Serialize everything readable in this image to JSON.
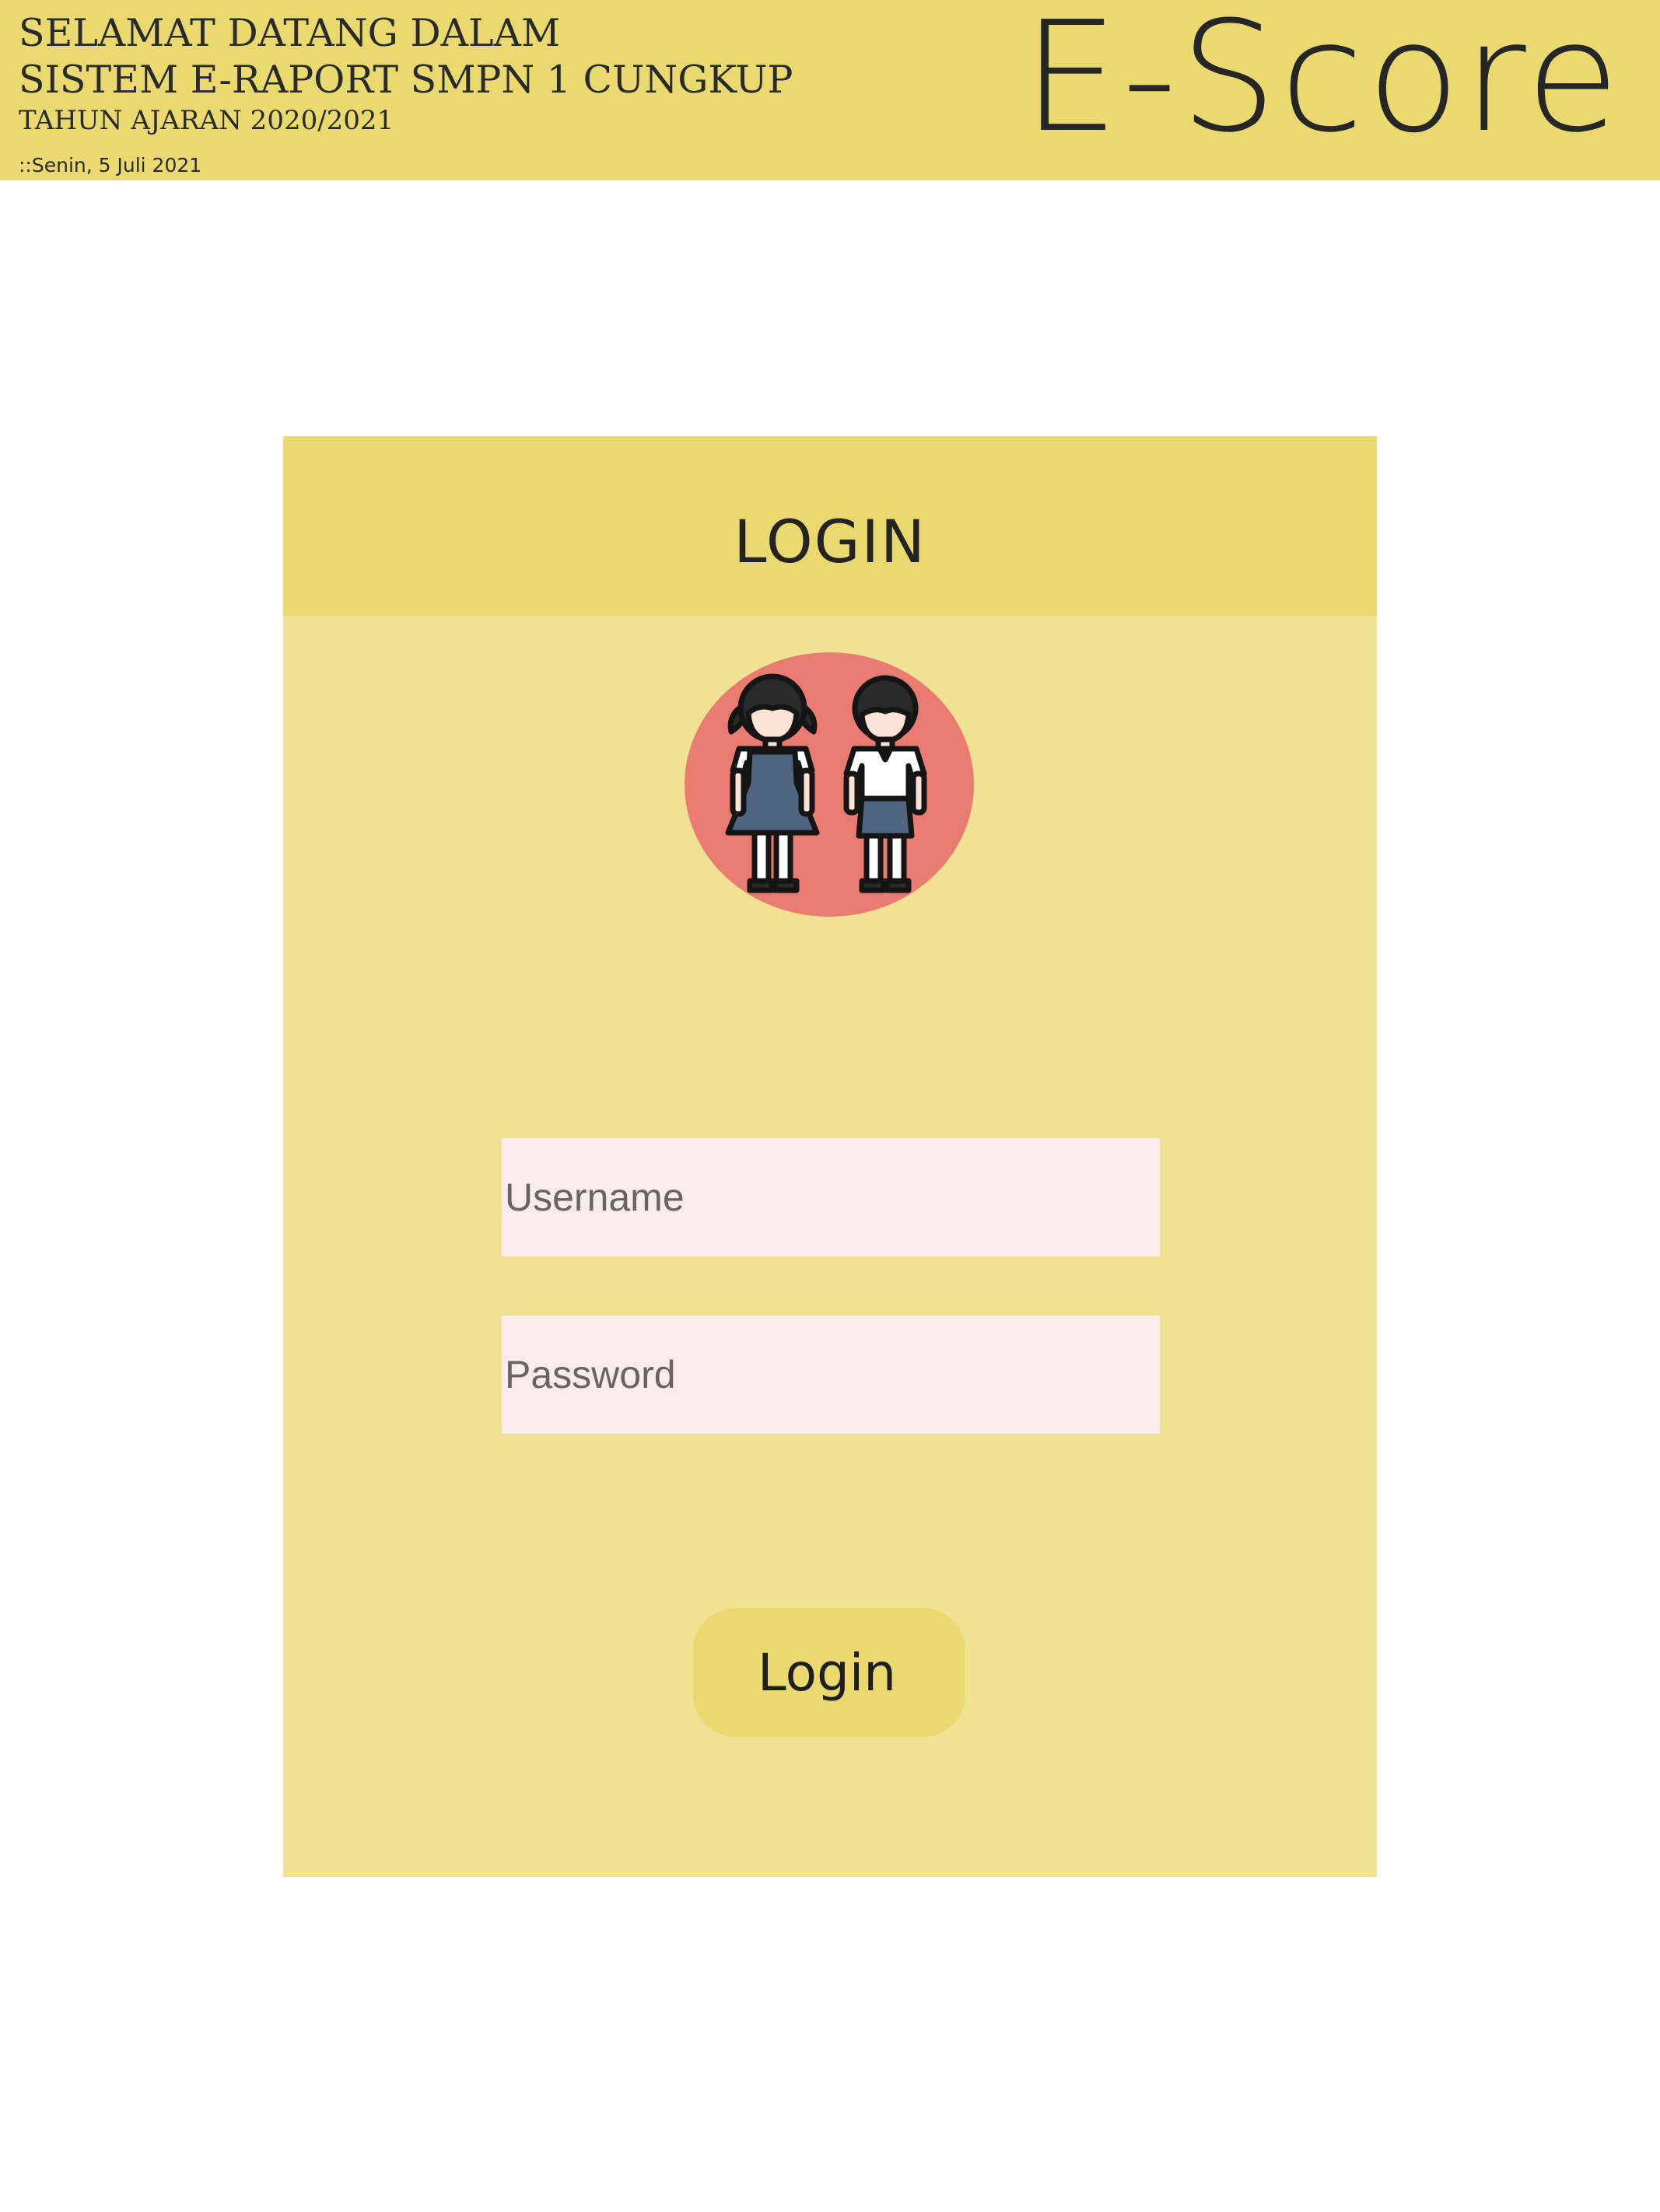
{
  "header": {
    "welcome_line1": "SELAMAT DATANG DALAM",
    "welcome_line2": "SISTEM E-RAPORT SMPN 1 CUNGKUP",
    "welcome_line3": "TAHUN AJARAN 2020/2021",
    "date": "::Senin, 5 Juli 2021",
    "brand": "E-Score"
  },
  "login_card": {
    "title": "LOGIN",
    "avatar_icon": "students-icon",
    "username_placeholder": "Username",
    "password_placeholder": "Password",
    "submit_label": "Login"
  },
  "colors": {
    "header_bg": "#e9d96e",
    "card_bg": "#f0e193",
    "field_bg": "#f9ecea",
    "avatar_circle": "#e97b70",
    "uniform_blue": "#4e6680"
  }
}
